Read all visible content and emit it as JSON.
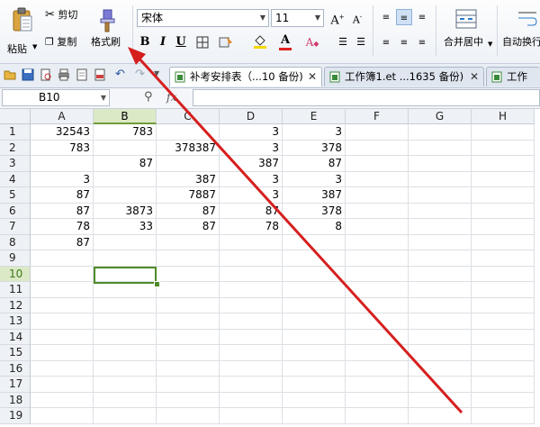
{
  "ribbon": {
    "paste_label": "粘贴",
    "cut_label": "剪切",
    "copy_label": "复制",
    "format_painter_label": "格式刷",
    "font_name": "宋体",
    "font_size": "11",
    "grow_font": "A",
    "shrink_font": "A",
    "bold": "B",
    "italic": "I",
    "underline": "U",
    "font_color_letter": "A",
    "merge_center_label": "合并居中",
    "wrap_text_label": "自动换行"
  },
  "tabs": [
    {
      "title": "补考安排表（...10 备份)",
      "active": true
    },
    {
      "title": "工作簿1.et ...1635 备份)",
      "active": false
    },
    {
      "title": "工作",
      "active": false
    }
  ],
  "formula_bar": {
    "name_box": "B10",
    "fx_label": "fx",
    "content": ""
  },
  "sheet": {
    "columns": [
      "A",
      "B",
      "C",
      "D",
      "E",
      "F",
      "G",
      "H"
    ],
    "selected_column": "B",
    "selected_row": "10",
    "rows": [
      {
        "num": "1",
        "cells": [
          "32543",
          "783",
          "",
          "3",
          "3",
          "",
          "",
          ""
        ]
      },
      {
        "num": "2",
        "cells": [
          "783",
          "",
          "378387",
          "3",
          "378",
          "",
          "",
          ""
        ]
      },
      {
        "num": "3",
        "cells": [
          "",
          "87",
          "",
          "387",
          "87",
          "",
          "",
          ""
        ]
      },
      {
        "num": "4",
        "cells": [
          "3",
          "",
          "387",
          "3",
          "3",
          "",
          "",
          ""
        ]
      },
      {
        "num": "5",
        "cells": [
          "87",
          "",
          "7887",
          "3",
          "387",
          "",
          "",
          ""
        ]
      },
      {
        "num": "6",
        "cells": [
          "87",
          "3873",
          "87",
          "87",
          "378",
          "",
          "",
          ""
        ]
      },
      {
        "num": "7",
        "cells": [
          "78",
          "33",
          "87",
          "78",
          "8",
          "",
          "",
          ""
        ]
      },
      {
        "num": "8",
        "cells": [
          "87",
          "",
          "",
          "",
          "",
          "",
          "",
          ""
        ]
      },
      {
        "num": "9",
        "cells": [
          "",
          "",
          "",
          "",
          "",
          "",
          "",
          ""
        ]
      },
      {
        "num": "10",
        "cells": [
          "",
          "",
          "",
          "",
          "",
          "",
          "",
          ""
        ]
      },
      {
        "num": "11",
        "cells": [
          "",
          "",
          "",
          "",
          "",
          "",
          "",
          ""
        ]
      },
      {
        "num": "12",
        "cells": [
          "",
          "",
          "",
          "",
          "",
          "",
          "",
          ""
        ]
      },
      {
        "num": "13",
        "cells": [
          "",
          "",
          "",
          "",
          "",
          "",
          "",
          ""
        ]
      },
      {
        "num": "14",
        "cells": [
          "",
          "",
          "",
          "",
          "",
          "",
          "",
          ""
        ]
      },
      {
        "num": "15",
        "cells": [
          "",
          "",
          "",
          "",
          "",
          "",
          "",
          ""
        ]
      },
      {
        "num": "16",
        "cells": [
          "",
          "",
          "",
          "",
          "",
          "",
          "",
          ""
        ]
      },
      {
        "num": "17",
        "cells": [
          "",
          "",
          "",
          "",
          "",
          "",
          "",
          ""
        ]
      },
      {
        "num": "18",
        "cells": [
          "",
          "",
          "",
          "",
          "",
          "",
          "",
          ""
        ]
      },
      {
        "num": "19",
        "cells": [
          "",
          "",
          "",
          "",
          "",
          "",
          "",
          ""
        ]
      }
    ]
  },
  "colors": {
    "selection_green": "#4f8a2a",
    "annotation_arrow": "#d61f1f",
    "font_color_bar": "#e02020",
    "highlight_bar": "#f5d800"
  }
}
